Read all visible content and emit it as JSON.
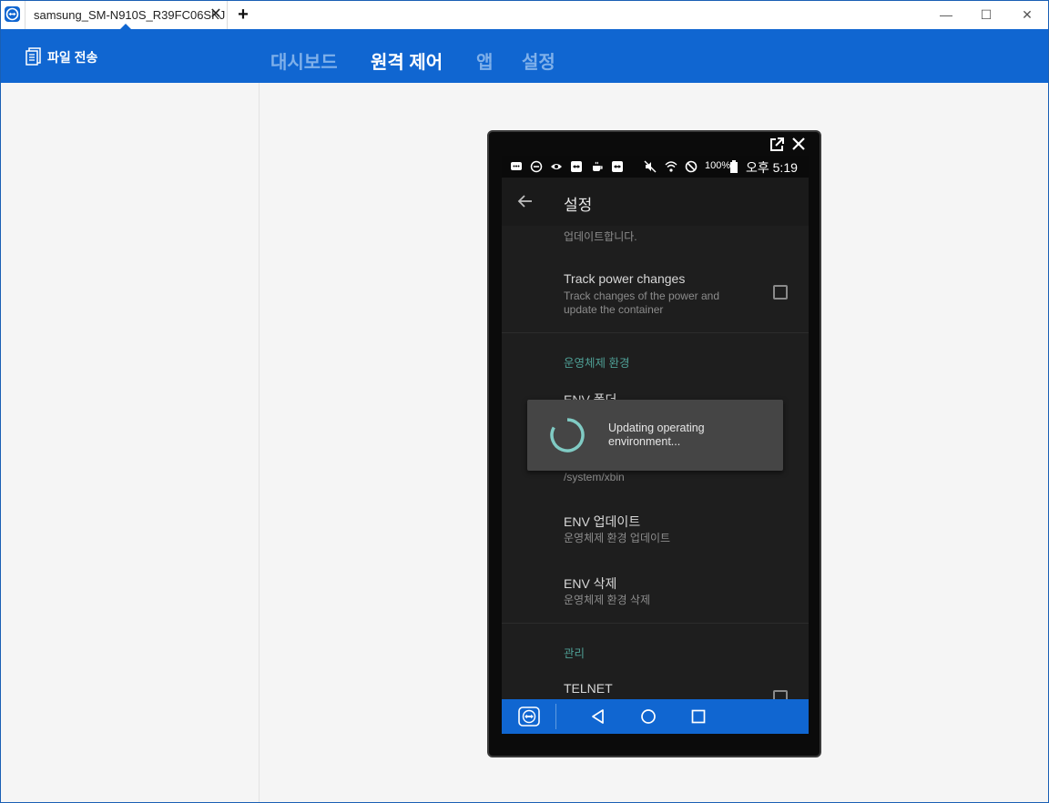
{
  "window": {
    "tab_title": "samsung_SM-N910S_R39FC06SKJ",
    "tab_close": "✕",
    "new_tab": "+",
    "minimize": "—",
    "maximize": "☐",
    "close": "✕"
  },
  "header": {
    "file_transfer_label": "파일 전송",
    "nav": [
      {
        "label": "대시보드",
        "active": false
      },
      {
        "label": "원격 제어",
        "active": true
      },
      {
        "label": "앱",
        "active": false
      },
      {
        "label": "설정",
        "active": false
      }
    ]
  },
  "device": {
    "status_bar": {
      "battery_percent": "100%",
      "time": "오후 5:19",
      "icons": [
        "message-icon",
        "dnd-icon",
        "eye-icon",
        "teamviewer-icon",
        "coffee-icon",
        "teamviewer-icon",
        "mute-icon",
        "wifi-icon",
        "blocked-icon",
        "battery-icon"
      ]
    },
    "app_bar": {
      "title": "설정"
    },
    "preferences": {
      "partial_summary": "업데이트합니다.",
      "track_power_title": "Track power changes",
      "track_power_summary_1": "Track changes of the power and",
      "track_power_summary_2": "update the container",
      "category_os_env": "운영체제 환경",
      "env_folder_title": "ENV 폴더",
      "env_folder_summary": "/system/xbin",
      "env_update_title": "ENV 업데이트",
      "env_update_summary": "운영체제 환경 업데이트",
      "env_delete_title": "ENV 삭제",
      "env_delete_summary": "운영체제 환경 삭제",
      "category_manage": "관리",
      "telnet_title": "TELNET"
    },
    "dialog": {
      "message_1": "Updating operating",
      "message_2": "environment..."
    }
  },
  "colors": {
    "brand_blue": "#1066d1",
    "accent_teal": "#4f9f95",
    "spinner_teal": "#80cbc4"
  }
}
